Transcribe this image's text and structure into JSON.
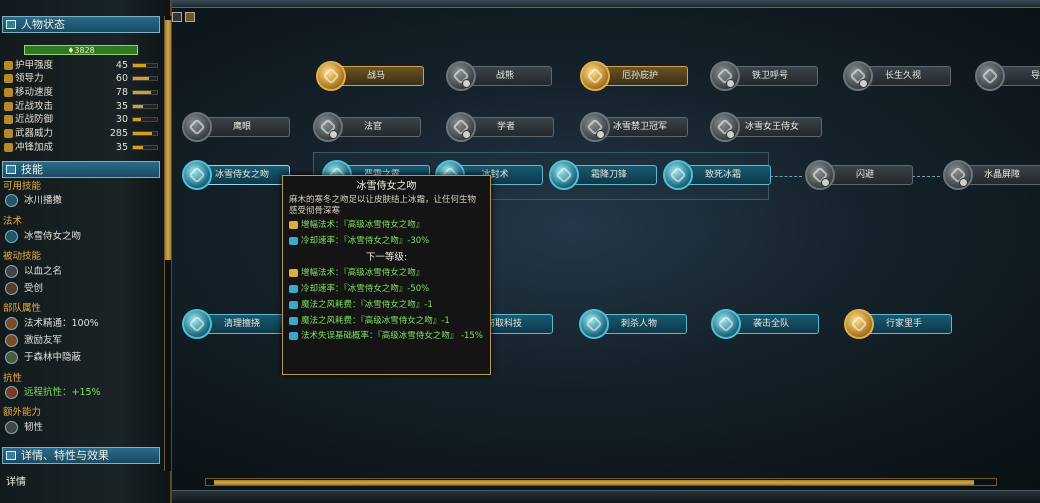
{
  "sidebar": {
    "character_status_title": "人物状态",
    "hp_value": "3828",
    "stats": [
      {
        "label": "护甲强度",
        "value": "45",
        "fill": 0.55
      },
      {
        "label": "领导力",
        "value": "60",
        "fill": 0.65
      },
      {
        "label": "移动速度",
        "value": "78",
        "fill": 0.75
      },
      {
        "label": "近战攻击",
        "value": "35",
        "fill": 0.4
      },
      {
        "label": "近战防御",
        "value": "30",
        "fill": 0.35
      },
      {
        "label": "武器威力",
        "value": "285",
        "fill": 0.8
      },
      {
        "label": "冲锋加成",
        "value": "35",
        "fill": 0.4
      }
    ],
    "skills_title": "技能",
    "cat_active": "可用技能",
    "active_skill": "冰川播撒",
    "cat_spells": "法术",
    "spell": "冰雪侍女之吻",
    "cat_passive": "被动技能",
    "passives": [
      "以血之名",
      "受创"
    ],
    "cat_unit": "部队属性",
    "unit_attrs": [
      "法术精通：100%",
      "激励友军",
      "于森林中隐蔽"
    ],
    "cat_resist": "抗性",
    "resist": "远程抗性：+15%",
    "cat_extra": "额外能力",
    "extra": "韧性",
    "details_section": "详情、特性与效果",
    "details_label": "详情"
  },
  "nodes": {
    "row1": [
      "战马",
      "战熊",
      "厄孙庇护",
      "铁卫呼号",
      "长生久视",
      "导"
    ],
    "row2": [
      "鹰眼",
      "法官",
      "学者",
      "冰雪禁卫冠军",
      "冰雪女王侍女"
    ],
    "row3": [
      "冰雪侍女之吻",
      "严霜之露",
      "冰封术",
      "霜降刀锋",
      "致死冰霜",
      "闪避",
      "水晶屏障"
    ],
    "row4": [
      "清理擅挠",
      "窃取科技",
      "刺杀人物",
      "袭击全队",
      "行家里手"
    ]
  },
  "tooltip": {
    "title": "冰雪侍女之吻",
    "desc": "麻木的寒冬之吻足以让皮肤结上冰霜，让任何生物感受彻骨深寒",
    "current": [
      "增幅法术：『高级冰雪侍女之吻』",
      "冷却速率：『冰雪侍女之吻』-30%"
    ],
    "next_header": "下一等级:",
    "next": [
      "增幅法术：『高级冰雪侍女之吻』",
      "冷却速率：『冰雪侍女之吻』-50%",
      "魔法之风耗费：『冰雪侍女之吻』-1",
      "魔法之风耗费：『高级冰雪侍女之吻』-1",
      "法术失误基础概率：『高级冰雪侍女之吻』 -15%"
    ]
  }
}
